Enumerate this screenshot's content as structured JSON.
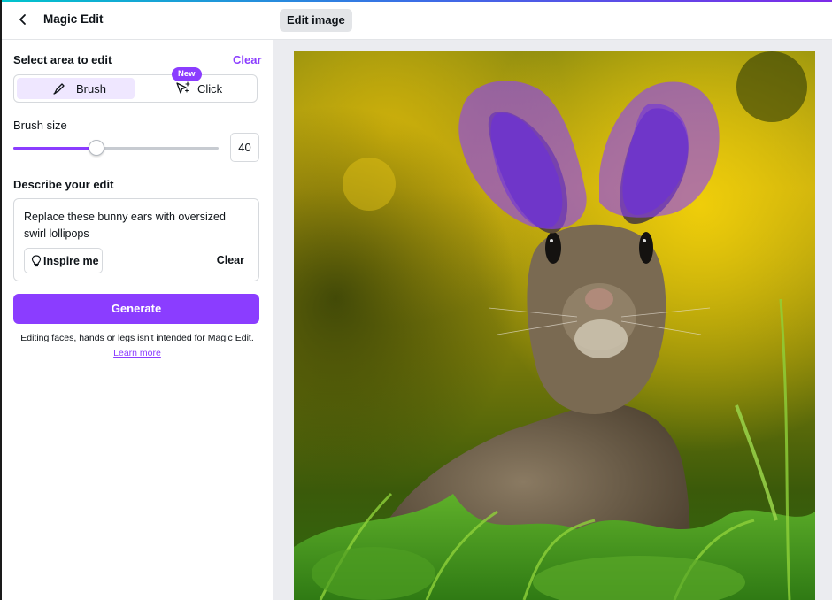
{
  "header": {
    "title": "Magic Edit",
    "back_icon": "chevron-left-icon"
  },
  "select_area": {
    "label": "Select area to edit",
    "clear_label": "Clear",
    "modes": [
      {
        "label": "Brush",
        "icon": "brush-icon",
        "selected": true
      },
      {
        "label": "Click",
        "icon": "sparkle-cursor-icon",
        "selected": false
      }
    ],
    "new_badge": "New"
  },
  "brush_size": {
    "label": "Brush size",
    "value": "40",
    "slider_fraction": 0.4
  },
  "describe": {
    "label": "Describe your edit",
    "text": "Replace these bunny ears with oversized swirl lollipops",
    "inspire_label": "Inspire me",
    "clear_label": "Clear"
  },
  "generate_label": "Generate",
  "notice": "Editing faces, hands or legs isn't intended for Magic Edit.",
  "learn_more": "Learn more",
  "toolbar": {
    "edit_image_label": "Edit image"
  },
  "colors": {
    "accent": "#8b3dff",
    "brush_mask": "#8b3dff"
  }
}
